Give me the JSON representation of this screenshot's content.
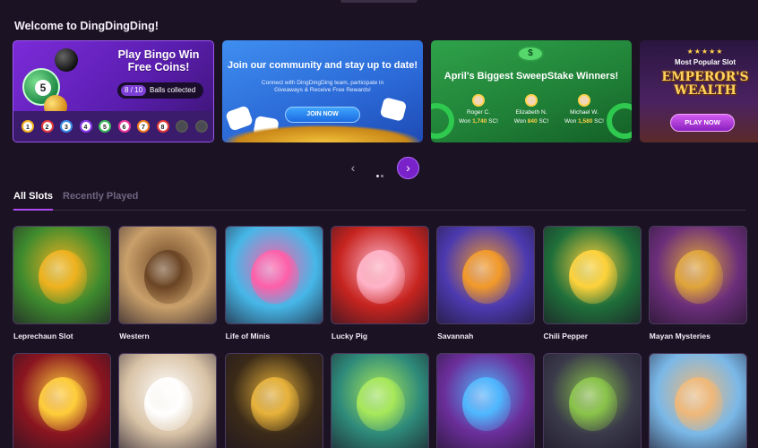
{
  "welcome": "Welcome to DingDingDing!",
  "banners": {
    "bingo": {
      "title": "Play Bingo Win Free Coins!",
      "collected": "8",
      "total": "/ 10",
      "label": "Balls collected",
      "big_ball": "5",
      "balls": [
        "1",
        "2",
        "3",
        "4",
        "5",
        "6",
        "7",
        "8",
        "",
        ""
      ]
    },
    "community": {
      "title": "Join our community and stay up to date!",
      "subtitle": "Connect with DingDingDing team, participate in Giveaways & Receive Free Rewards!",
      "button": "JOIN NOW"
    },
    "sweepstake": {
      "coin": "$",
      "title": "April's Biggest SweepStake Winners!",
      "winners": [
        {
          "name": "Roger C.",
          "prefix": "Won",
          "amount": "1,740",
          "unit": "SC!"
        },
        {
          "name": "Elizabeth N.",
          "prefix": "Won",
          "amount": "840",
          "unit": "SC!"
        },
        {
          "name": "Michael W.",
          "prefix": "Won",
          "amount": "1,580",
          "unit": "SC!"
        }
      ]
    },
    "popular": {
      "stars": "★★★★★",
      "label": "Most Popular Slot",
      "logo_line1": "EMPEROR'S",
      "logo_line2": "WEALTH",
      "button": "PLAY NOW"
    }
  },
  "nav": {
    "prev": "‹",
    "next": "›"
  },
  "tabs": {
    "all": "All Slots",
    "recent": "Recently Played"
  },
  "games_row1": [
    {
      "name": "Leprechaun Slot",
      "bg": "#3e8a2e",
      "accent": "#f0b21e"
    },
    {
      "name": "Western",
      "bg": "#c9a06a",
      "accent": "#6a4424"
    },
    {
      "name": "Life of Minis",
      "bg": "#46b7e8",
      "accent": "#ff5fa8"
    },
    {
      "name": "Lucky Pig",
      "bg": "#c6241f",
      "accent": "#ffb3c8"
    },
    {
      "name": "Savannah",
      "bg": "#4c3ab0",
      "accent": "#f39a28"
    },
    {
      "name": "Chili Pepper",
      "bg": "#1f6f3a",
      "accent": "#ffd23a"
    },
    {
      "name": "Mayan Mysteries",
      "bg": "#6b2e7a",
      "accent": "#e0a53a"
    }
  ],
  "games_row2": [
    {
      "name": "",
      "bg": "#8a1520",
      "accent": "#ffce3a"
    },
    {
      "name": "",
      "bg": "#d9c3a6",
      "accent": "#ffffff"
    },
    {
      "name": "",
      "bg": "#3a2a18",
      "accent": "#e7b23a"
    },
    {
      "name": "",
      "bg": "#2e8a7a",
      "accent": "#a8e85a"
    },
    {
      "name": "",
      "bg": "#6b2e9a",
      "accent": "#4fb8ff"
    },
    {
      "name": "",
      "bg": "#3a3a4a",
      "accent": "#8ac44a"
    },
    {
      "name": "",
      "bg": "#7ab8e8",
      "accent": "#f0b878"
    }
  ]
}
